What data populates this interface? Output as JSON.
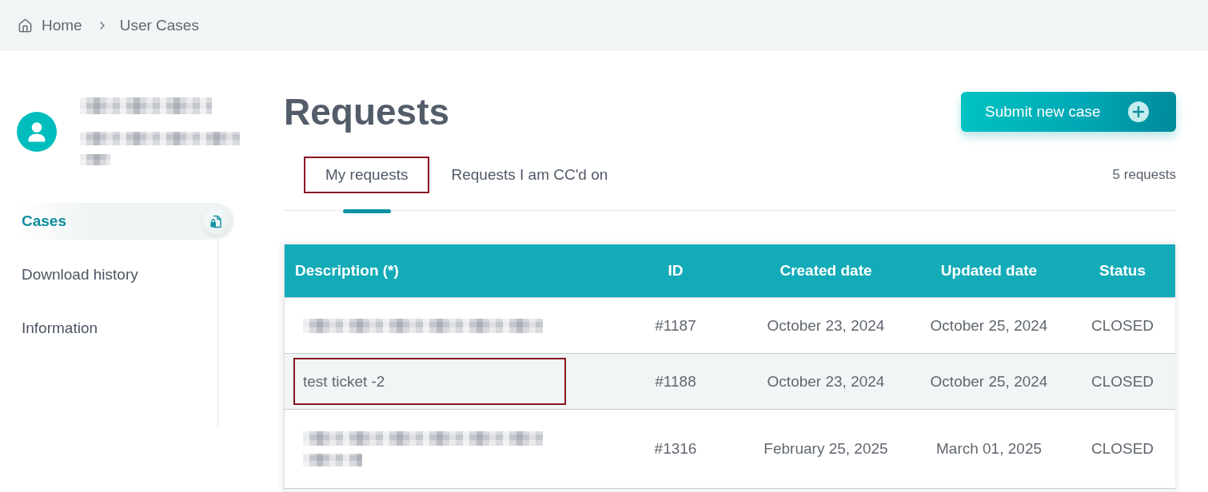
{
  "breadcrumb": [
    {
      "kind": "home",
      "label": "Home"
    },
    {
      "kind": "current",
      "label": "User Cases"
    }
  ],
  "profile": {
    "name": {
      "kind": "redacted",
      "wrapped": false
    },
    "email": {
      "kind": "redacted",
      "wrapped": true
    }
  },
  "sidebar": {
    "items": [
      {
        "label": "Cases",
        "selected": true
      },
      {
        "label": "Download history",
        "selected": false
      },
      {
        "label": "Information",
        "selected": false
      }
    ]
  },
  "page": {
    "title": "Requests",
    "primary_button": "Submit new case"
  },
  "tabs": [
    {
      "label": "My requests",
      "selected": true,
      "outlined": true
    },
    {
      "label": "Requests I am CC'd on",
      "selected": false,
      "outlined": false
    }
  ],
  "request_count": "5 requests",
  "table": {
    "columns": [
      "Description (*)",
      "ID",
      "Created date",
      "Updated date",
      "Status"
    ],
    "rows": [
      {
        "description": {
          "kind": "redacted",
          "wrapped": false,
          "outlined": false
        },
        "id": "#1187",
        "created": "October 23, 2024",
        "updated": "October 25, 2024",
        "status": "CLOSED"
      },
      {
        "description": {
          "kind": "text",
          "text": "test ticket -2",
          "outlined": true
        },
        "id": "#1188",
        "created": "October 23, 2024",
        "updated": "October 25, 2024",
        "status": "CLOSED"
      },
      {
        "description": {
          "kind": "redacted",
          "wrapped": true,
          "outlined": false
        },
        "id": "#1316",
        "created": "February 25, 2025",
        "updated": "March 01, 2025",
        "status": "CLOSED"
      }
    ]
  }
}
